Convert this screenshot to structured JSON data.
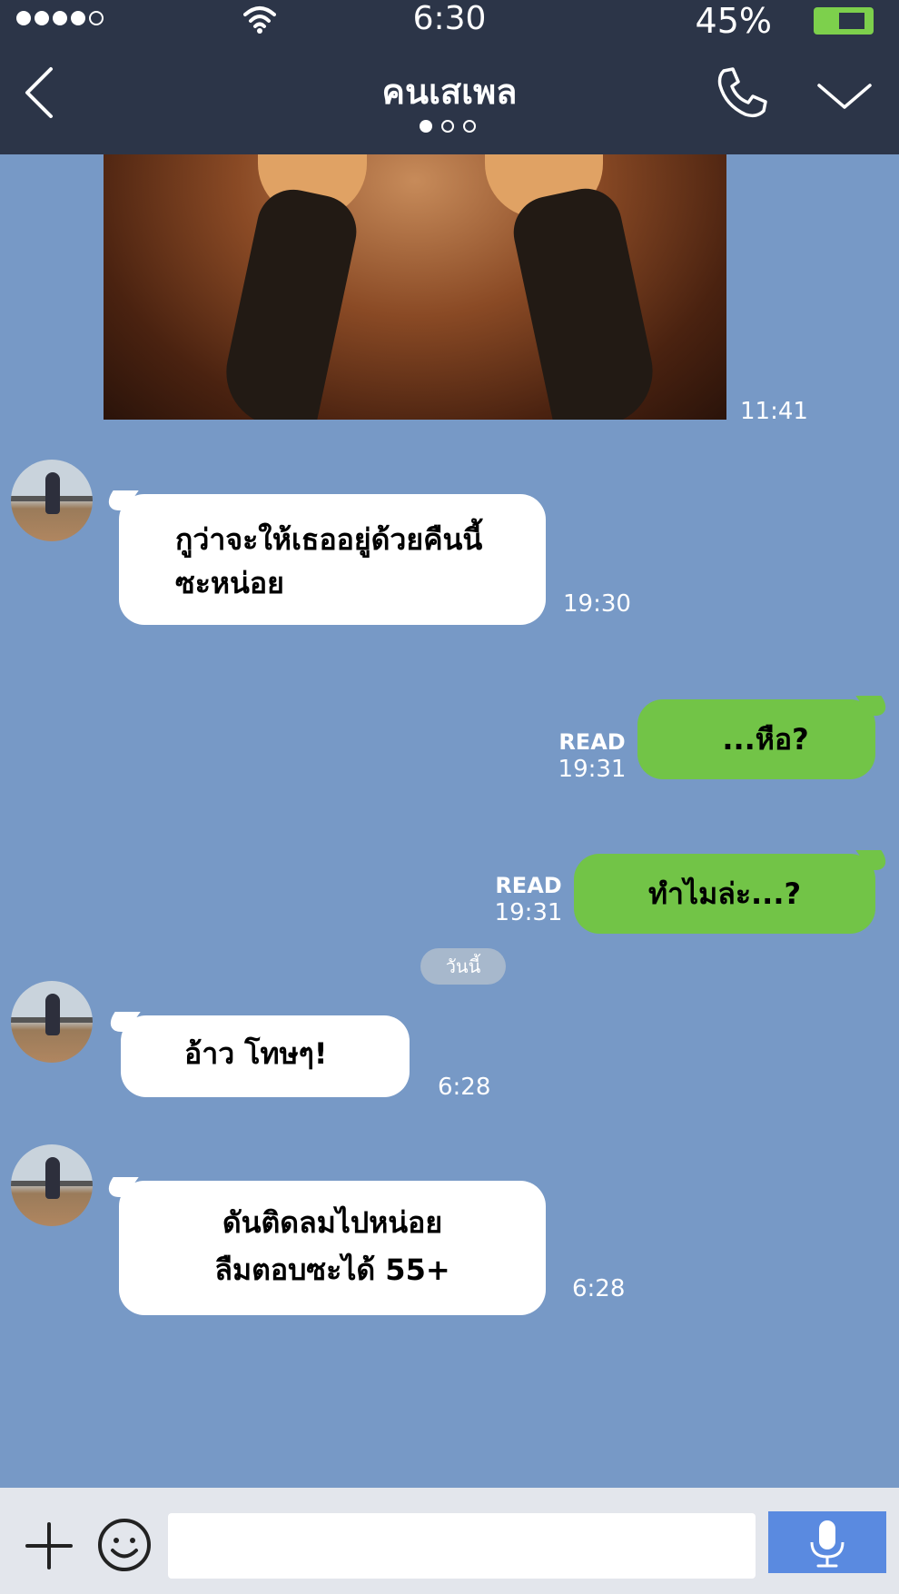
{
  "status_bar": {
    "time": "6:30",
    "battery_percent": "45%",
    "signal_dots_filled": 4,
    "signal_dots_total": 5,
    "icons": [
      "wifi-icon",
      "battery-icon"
    ]
  },
  "header": {
    "title": "คนเสเพล",
    "page_indicator": {
      "active": 1,
      "total": 3
    },
    "icons": [
      "back-icon",
      "phone-icon",
      "chevron-down-icon"
    ]
  },
  "messages": [
    {
      "type": "image",
      "direction": "outgoing",
      "time": "11:41"
    },
    {
      "type": "text",
      "direction": "incoming",
      "lines": [
        "กูว่าจะให้เธออยู่ด้วยคืนนี้",
        "ซะหน่อย"
      ],
      "time": "19:30"
    },
    {
      "type": "text",
      "direction": "outgoing",
      "lines": [
        "...หือ?"
      ],
      "read": "READ",
      "time": "19:31"
    },
    {
      "type": "text",
      "direction": "outgoing",
      "lines": [
        "ทำไมล่ะ...?"
      ],
      "read": "READ",
      "time": "19:31"
    },
    {
      "type": "date",
      "label": "วันนี้"
    },
    {
      "type": "text",
      "direction": "incoming",
      "lines": [
        "อ้าว โทษๆ!"
      ],
      "time": "6:28"
    },
    {
      "type": "text",
      "direction": "incoming",
      "lines": [
        "ดันติดลมไปหน่อย",
        "ลืมตอบซะได้ 55+"
      ],
      "time": "6:28"
    }
  ],
  "input_bar": {
    "placeholder": "",
    "icons": [
      "plus-icon",
      "emoji-icon",
      "microphone-icon"
    ]
  },
  "colors": {
    "header_bg": "#2c3548",
    "chat_bg": "#7799c6",
    "outgoing_bubble": "#72c447",
    "incoming_bubble": "#ffffff",
    "mic_button": "#5a8ae0",
    "battery": "#7dd04c"
  }
}
